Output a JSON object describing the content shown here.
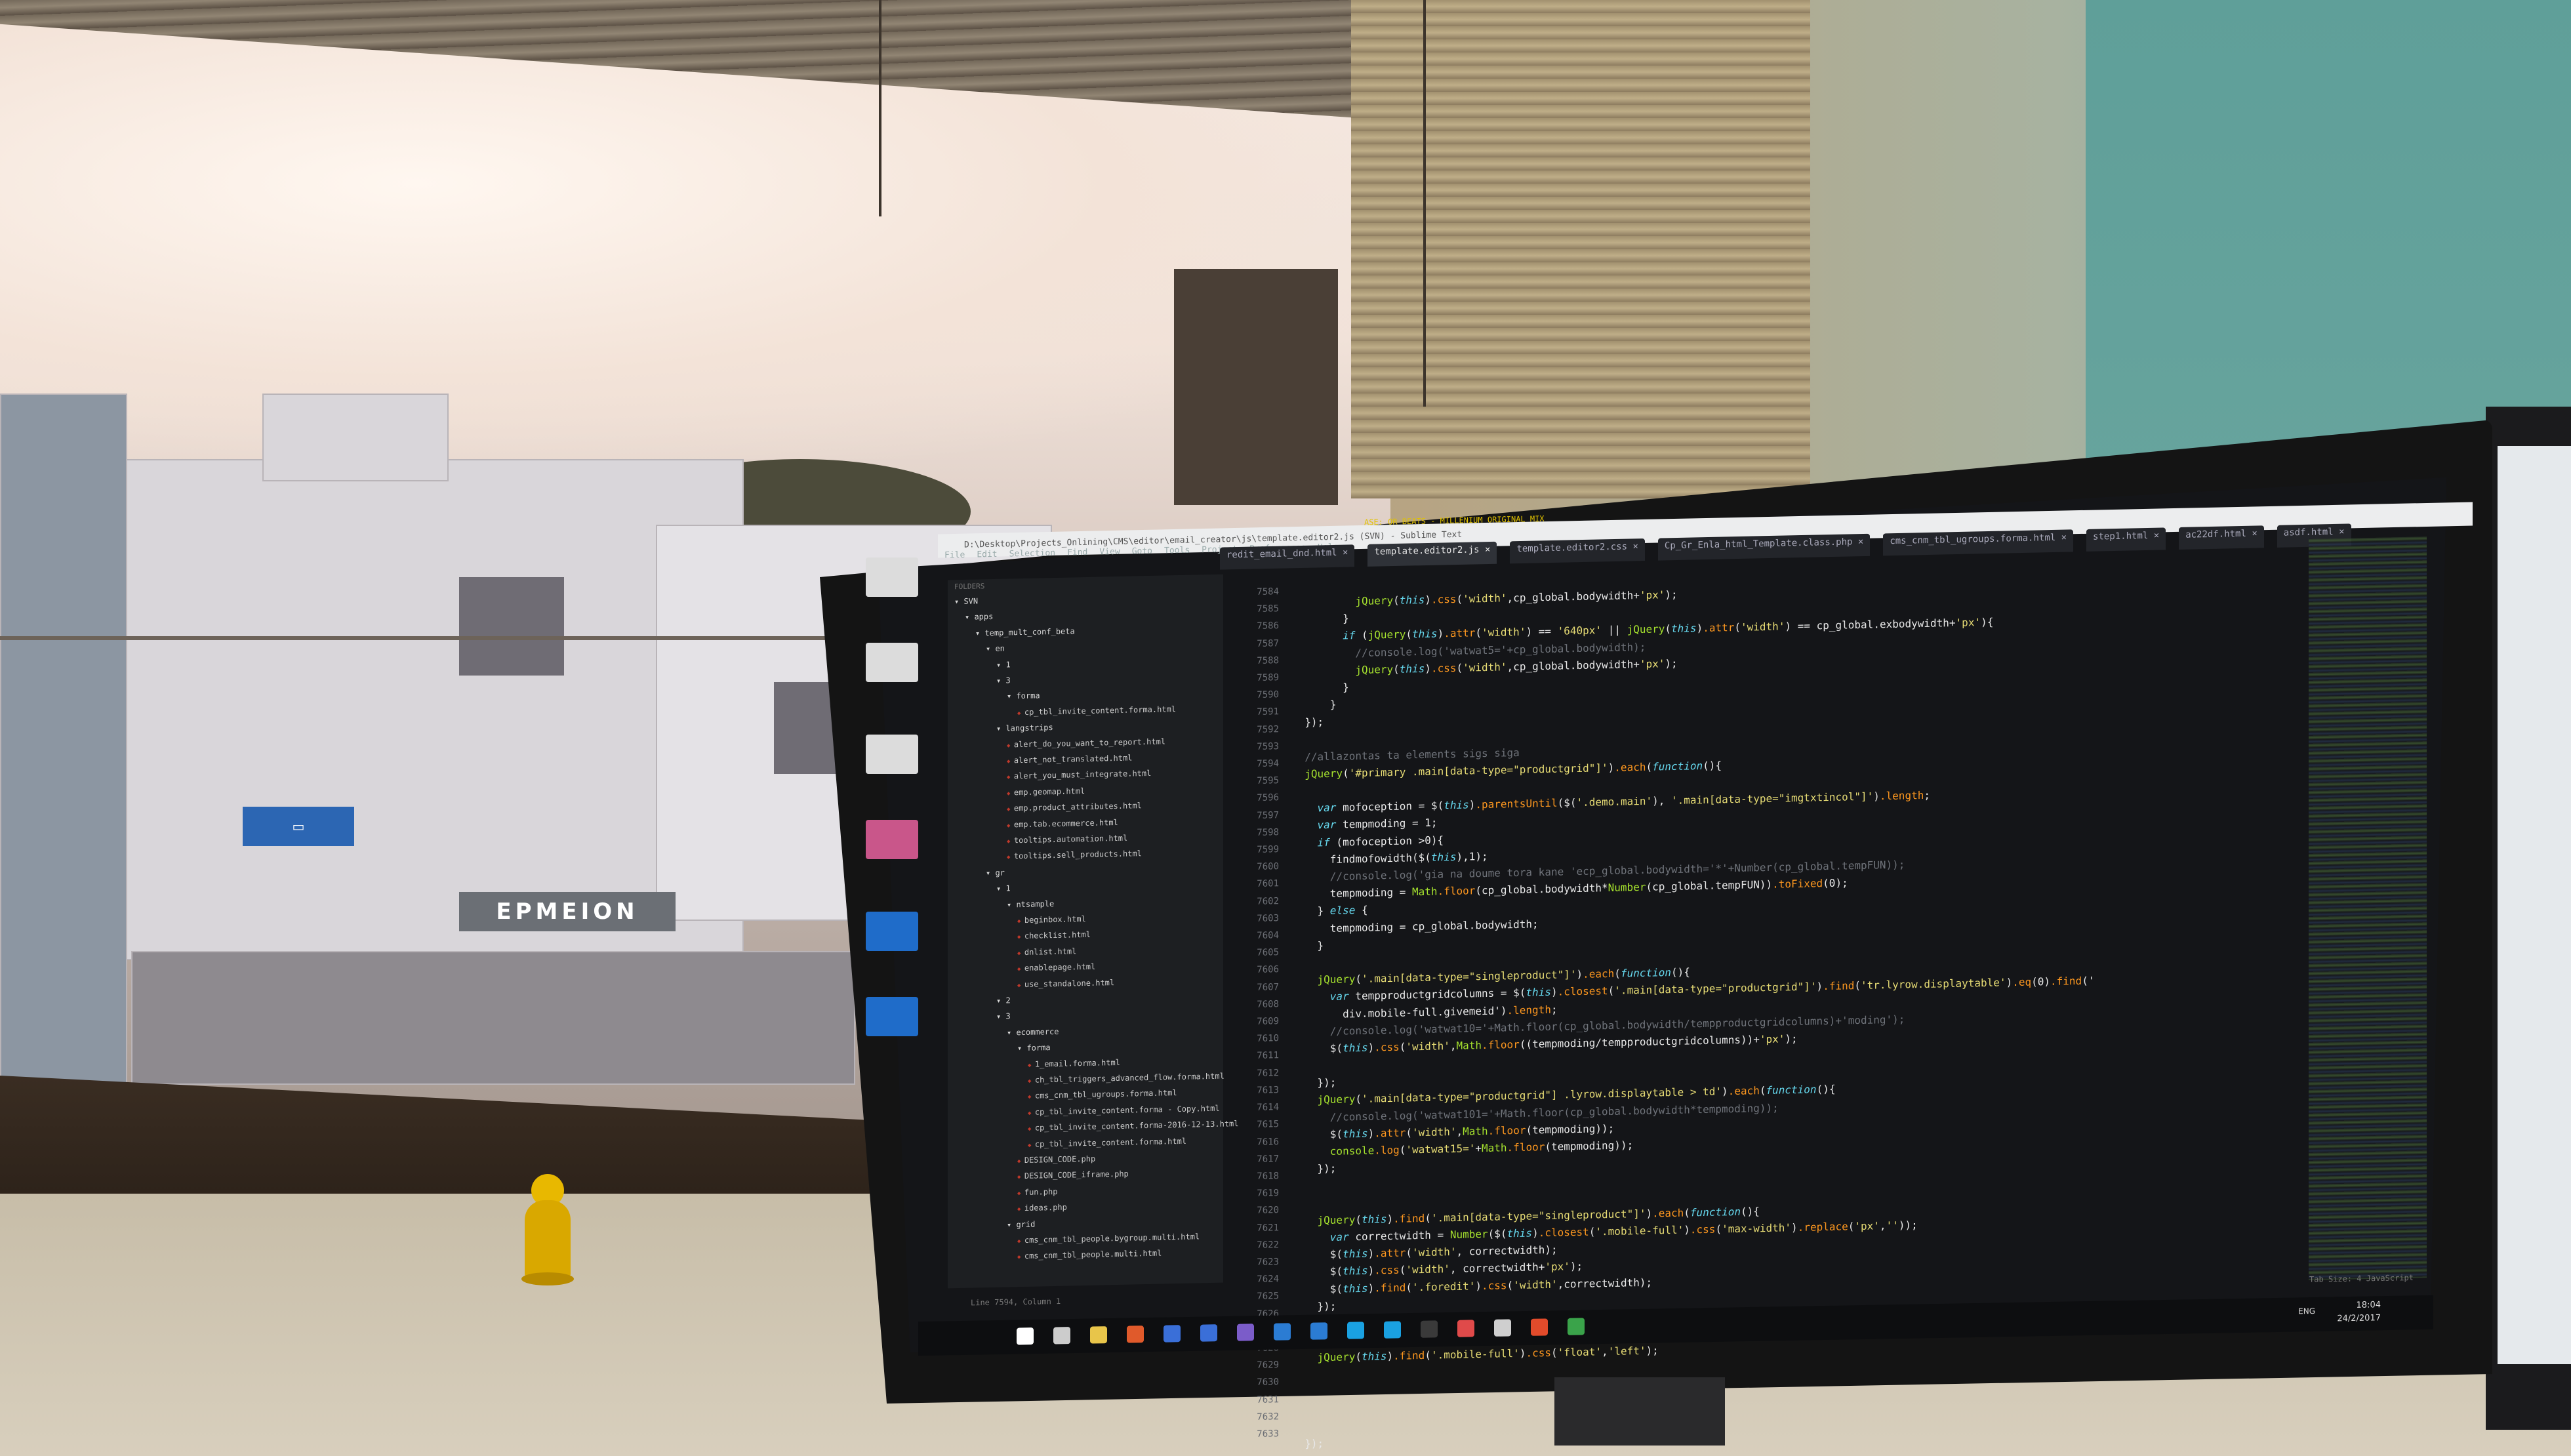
{
  "scene": {
    "description_colors": {
      "teal_wall": "#6aa69f",
      "sky": "#f3e3d8",
      "desk": "#d8cfbd"
    },
    "outside_sign": "ΕΡΜΕΙΟΝ"
  },
  "osd_text": "ASE: OR BEATS - MILLENIUM ORIGINAL MIX",
  "editor": {
    "title": "D:\\Desktop\\Projects_Onlining\\CMS\\editor\\email_creator\\js\\template.editor2.js (SVN) - Sublime Text",
    "menu": [
      "File",
      "Edit",
      "Selection",
      "Find",
      "View",
      "Goto",
      "Tools",
      "Project",
      "Preferences",
      "Help"
    ],
    "tabs": [
      "redit_email_dnd.html",
      "template.editor2.js",
      "template.editor2.css",
      "Cp_Gr_Enla_html_Template.class.php",
      "cms_cnm_tbl_ugroups.forma.html",
      "step1.html",
      "ac22df.html",
      "asdf.html"
    ],
    "active_tab": 1,
    "sidebar": {
      "header": "FOLDERS",
      "items": [
        {
          "label": "SVN",
          "kind": "folder",
          "depth": 0
        },
        {
          "label": "apps",
          "kind": "folder",
          "depth": 1
        },
        {
          "label": "temp_mult_conf_beta",
          "kind": "folder",
          "depth": 2
        },
        {
          "label": "en",
          "kind": "folder",
          "depth": 3
        },
        {
          "label": "1",
          "kind": "folder",
          "depth": 4
        },
        {
          "label": "3",
          "kind": "folder",
          "depth": 4
        },
        {
          "label": "forma",
          "kind": "folder",
          "depth": 5
        },
        {
          "label": "cp_tbl_invite_content.forma.html",
          "kind": "file",
          "depth": 6
        },
        {
          "label": "langstrips",
          "kind": "folder",
          "depth": 4
        },
        {
          "label": "alert_do_you_want_to_report.html",
          "kind": "file",
          "depth": 5
        },
        {
          "label": "alert_not_translated.html",
          "kind": "file",
          "depth": 5
        },
        {
          "label": "alert_you_must_integrate.html",
          "kind": "file",
          "depth": 5
        },
        {
          "label": "emp.geomap.html",
          "kind": "file",
          "depth": 5
        },
        {
          "label": "emp.product_attributes.html",
          "kind": "file",
          "depth": 5
        },
        {
          "label": "emp.tab.ecommerce.html",
          "kind": "file",
          "depth": 5
        },
        {
          "label": "tooltips.automation.html",
          "kind": "file",
          "depth": 5
        },
        {
          "label": "tooltips.sell_products.html",
          "kind": "file",
          "depth": 5
        },
        {
          "label": "gr",
          "kind": "folder",
          "depth": 3
        },
        {
          "label": "1",
          "kind": "folder",
          "depth": 4
        },
        {
          "label": "ntsample",
          "kind": "folder",
          "depth": 5
        },
        {
          "label": "beginbox.html",
          "kind": "file",
          "depth": 6
        },
        {
          "label": "checklist.html",
          "kind": "file",
          "depth": 6
        },
        {
          "label": "dnlist.html",
          "kind": "file",
          "depth": 6
        },
        {
          "label": "enablepage.html",
          "kind": "file",
          "depth": 6
        },
        {
          "label": "use_standalone.html",
          "kind": "file",
          "depth": 6
        },
        {
          "label": "2",
          "kind": "folder",
          "depth": 4
        },
        {
          "label": "3",
          "kind": "folder",
          "depth": 4
        },
        {
          "label": "ecommerce",
          "kind": "folder",
          "depth": 5
        },
        {
          "label": "forma",
          "kind": "folder",
          "depth": 6
        },
        {
          "label": "1_email.forma.html",
          "kind": "file",
          "depth": 7
        },
        {
          "label": "ch_tbl_triggers_advanced_flow.forma.html",
          "kind": "file",
          "depth": 7
        },
        {
          "label": "cms_cnm_tbl_ugroups.forma.html",
          "kind": "file",
          "depth": 7
        },
        {
          "label": "cp_tbl_invite_content.forma - Copy.html",
          "kind": "file",
          "depth": 7
        },
        {
          "label": "cp_tbl_invite_content.forma-2016-12-13.html",
          "kind": "file",
          "depth": 7
        },
        {
          "label": "cp_tbl_invite_content.forma.html",
          "kind": "file",
          "depth": 7
        },
        {
          "label": "DESIGN_CODE.php",
          "kind": "file",
          "depth": 6
        },
        {
          "label": "DESIGN_CODE_iframe.php",
          "kind": "file",
          "depth": 6
        },
        {
          "label": "fun.php",
          "kind": "file",
          "depth": 6
        },
        {
          "label": "ideas.php",
          "kind": "file",
          "depth": 6
        },
        {
          "label": "grid",
          "kind": "folder",
          "depth": 5
        },
        {
          "label": "cms_cnm_tbl_people.bygroup.multi.html",
          "kind": "file",
          "depth": 6
        },
        {
          "label": "cms_cnm_tbl_people.multi.html",
          "kind": "file",
          "depth": 6
        }
      ]
    },
    "line_numbers": [
      "7584",
      "7585",
      "7586",
      "7587",
      "7588",
      "7589",
      "7590",
      "7591",
      "7592",
      "7593",
      "7594",
      "7595",
      "7596",
      "7597",
      "7598",
      "7599",
      "7600",
      "7601",
      "7602",
      "7603",
      "7604",
      "7605",
      "7606",
      "7607",
      "7608",
      "7609",
      "7610",
      "7611",
      "7612",
      "7613",
      "7614",
      "7615",
      "7616",
      "7617",
      "7618",
      "7619",
      "7620",
      "7621",
      "7622",
      "7623",
      "7624",
      "7625",
      "7626",
      "7627",
      "7628",
      "7629",
      "7630",
      "7631",
      "7632",
      "7633"
    ],
    "code_lines": [
      "          jQuery(this).css('width',cp_global.bodywidth+'px');",
      "        }",
      "        if (jQuery(this).attr('width') == '640px' || jQuery(this).attr('width') == cp_global.exbodywidth+'px'){",
      "          //console.log('watwat5='+cp_global.bodywidth);",
      "          jQuery(this).css('width',cp_global.bodywidth+'px');",
      "        }",
      "      }",
      "  });",
      "",
      "  //allazontas ta elements sigs siga",
      "  jQuery('#primary .main[data-type=\"productgrid\"]').each(function(){",
      "",
      "    var mofoception = $(this).parentsUntil($('.demo.main'), '.main[data-type=\"imgtxtincol\"]').length;",
      "    var tempmoding = 1;",
      "    if (mofoception >0){",
      "      findmofowidth($(this),1);",
      "      //console.log('gia na doume tora kane 'ecp_global.bodywidth='*'+Number(cp_global.tempFUN));",
      "      tempmoding = Math.floor(cp_global.bodywidth*Number(cp_global.tempFUN)).toFixed(0);",
      "    } else {",
      "      tempmoding = cp_global.bodywidth;",
      "    }",
      "",
      "    jQuery('.main[data-type=\"singleproduct\"]').each(function(){",
      "      var tempproductgridcolumns = $(this).closest('.main[data-type=\"productgrid\"]').find('tr.lyrow.displaytable').eq(0).find('",
      "        div.mobile-full.givemeid').length;",
      "      //console.log('watwat10='+Math.floor(cp_global.bodywidth/tempproductgridcolumns)+'moding');",
      "      $(this).css('width',Math.floor((tempmoding/tempproductgridcolumns))+'px');",
      "",
      "    });",
      "    jQuery('.main[data-type=\"productgrid\"] .lyrow.displaytable > td').each(function(){",
      "      //console.log('watwat101='+Math.floor(cp_global.bodywidth*tempmoding));",
      "      $(this).attr('width',Math.floor(tempmoding));",
      "      console.log('watwat15='+Math.floor(tempmoding));",
      "    });",
      "",
      "",
      "    jQuery(this).find('.main[data-type=\"singleproduct\"]').each(function(){",
      "      var correctwidth = Number($(this).closest('.mobile-full').css('max-width').replace('px',''));",
      "      $(this).attr('width', correctwidth);",
      "      $(this).css('width', correctwidth+'px');",
      "      $(this).find('.foredit').css('width',correctwidth);",
      "    });",
      "",
      "",
      "    jQuery(this).find('.mobile-full').css('float','left');",
      "",
      "",
      "",
      "",
      "  });"
    ],
    "status_left": "Line 7594, Column 1",
    "status_right": "Tab Size: 4     JavaScript"
  },
  "taskbar": {
    "lang": "ENG",
    "time": "18:04",
    "date": "24/2/2017",
    "app_colors": [
      "#ffffff",
      "#cccccc",
      "#e8c54a",
      "#e05a2b",
      "#3a6fd8",
      "#3a6fd8",
      "#7b5cc9",
      "#2b7cd3",
      "#2b7cd3",
      "#1aa1e1",
      "#1aa1e1",
      "#3a3a3a",
      "#e04a4a",
      "#cfcfcf",
      "#e24b2b",
      "#3aa34a"
    ]
  }
}
